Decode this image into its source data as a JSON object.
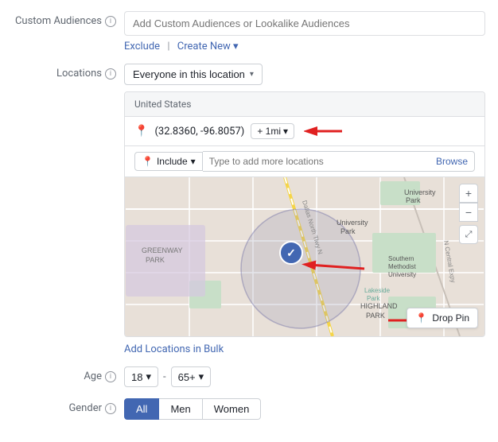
{
  "customAudiences": {
    "label": "Custom Audiences",
    "inputPlaceholder": "Add Custom Audiences or Lookalike Audiences",
    "excludeLabel": "Exclude",
    "createNewLabel": "Create New"
  },
  "locations": {
    "label": "Locations",
    "dropdownValue": "Everyone in this location",
    "countryLabel": "United States",
    "coordinates": "(32.8360, -96.8057)",
    "radius": "+ 1mi",
    "includeLabel": "Include",
    "inputPlaceholder": "Type to add more locations",
    "browseLabel": "Browse",
    "dropPinLabel": "Drop Pin",
    "addBulkLabel": "Add Locations in Bulk"
  },
  "age": {
    "label": "Age",
    "minValue": "18",
    "maxValue": "65+",
    "separator": "-"
  },
  "gender": {
    "label": "Gender",
    "options": [
      {
        "label": "All",
        "active": true
      },
      {
        "label": "Men",
        "active": false
      },
      {
        "label": "Women",
        "active": false
      }
    ]
  },
  "icons": {
    "info": "i",
    "caret": "▾",
    "pin": "📍",
    "zoomIn": "+",
    "zoomOut": "−",
    "expand": "⤢",
    "pinDrop": "📍"
  }
}
